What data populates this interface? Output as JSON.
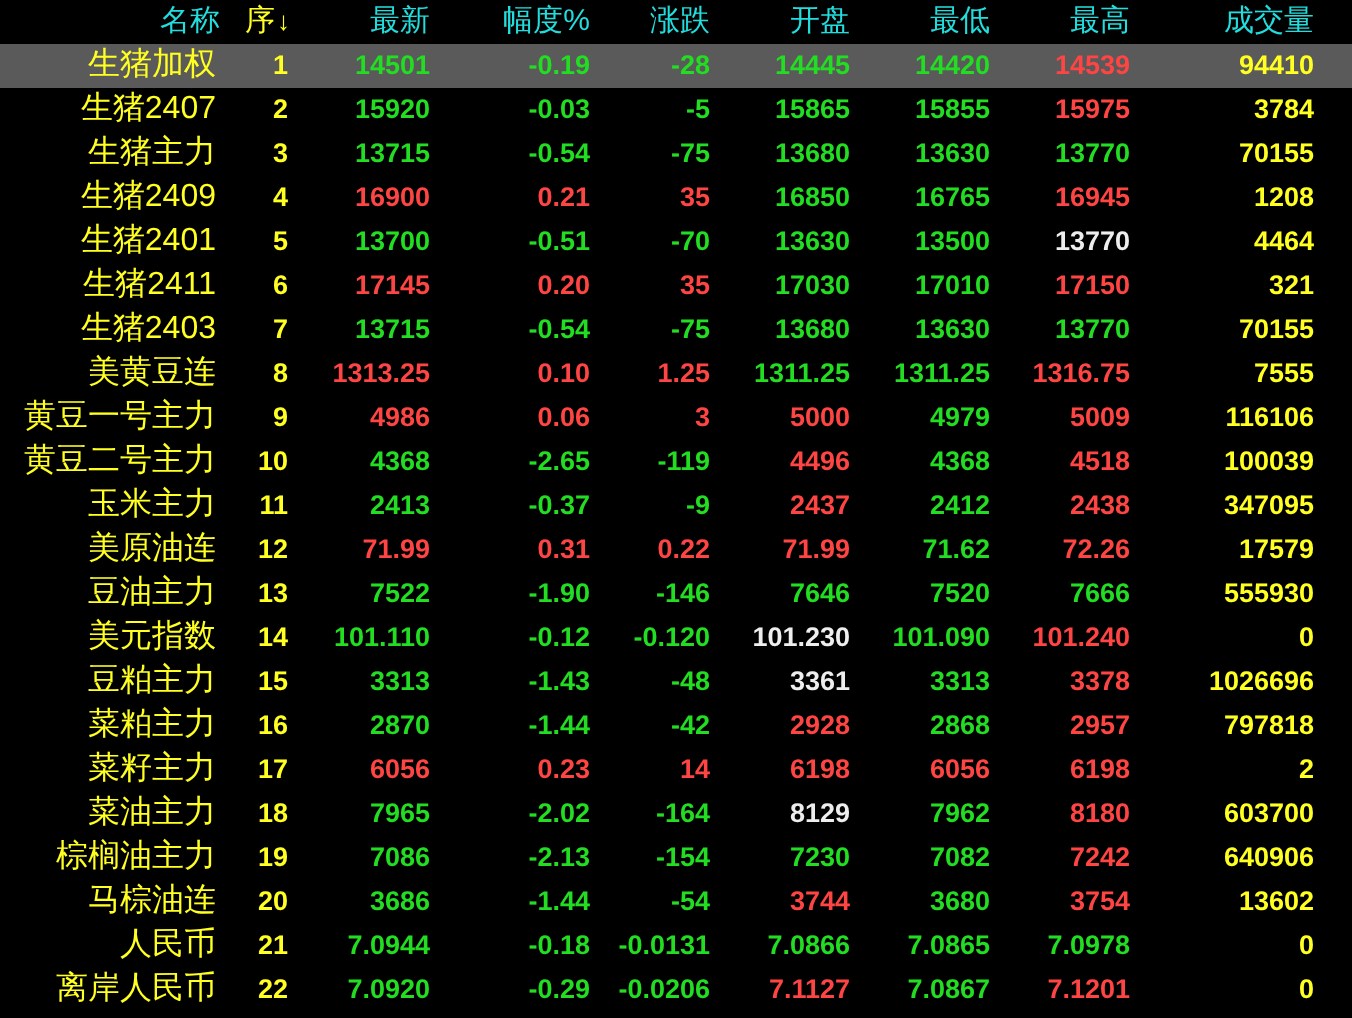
{
  "table": {
    "columns": [
      {
        "label": "名称",
        "sorted": false
      },
      {
        "label": "序",
        "sorted": true
      },
      {
        "label": "最新",
        "sorted": false
      },
      {
        "label": "幅度%",
        "sorted": false
      },
      {
        "label": "涨跌",
        "sorted": false
      },
      {
        "label": "开盘",
        "sorted": false
      },
      {
        "label": "最低",
        "sorted": false
      },
      {
        "label": "最高",
        "sorted": false
      },
      {
        "label": "成交量",
        "sorted": false
      }
    ],
    "sort_arrow": "↓",
    "rows": [
      {
        "selected": true,
        "cells": [
          {
            "text": "生猪加权",
            "color": "#ffff22"
          },
          {
            "text": "1",
            "color": "#ffff22"
          },
          {
            "text": "14501",
            "color": "#22dd22"
          },
          {
            "text": "-0.19",
            "color": "#22dd22"
          },
          {
            "text": "-28",
            "color": "#22dd22"
          },
          {
            "text": "14445",
            "color": "#22dd22"
          },
          {
            "text": "14420",
            "color": "#22dd22"
          },
          {
            "text": "14539",
            "color": "#ff4444"
          },
          {
            "text": "94410",
            "color": "#ffff22"
          }
        ]
      },
      {
        "selected": false,
        "cells": [
          {
            "text": "生猪2407",
            "color": "#ffff22"
          },
          {
            "text": "2",
            "color": "#ffff22"
          },
          {
            "text": "15920",
            "color": "#22dd22"
          },
          {
            "text": "-0.03",
            "color": "#22dd22"
          },
          {
            "text": "-5",
            "color": "#22dd22"
          },
          {
            "text": "15865",
            "color": "#22dd22"
          },
          {
            "text": "15855",
            "color": "#22dd22"
          },
          {
            "text": "15975",
            "color": "#ff4444"
          },
          {
            "text": "3784",
            "color": "#ffff22"
          }
        ]
      },
      {
        "selected": false,
        "cells": [
          {
            "text": "生猪主力",
            "color": "#ffff22"
          },
          {
            "text": "3",
            "color": "#ffff22"
          },
          {
            "text": "13715",
            "color": "#22dd22"
          },
          {
            "text": "-0.54",
            "color": "#22dd22"
          },
          {
            "text": "-75",
            "color": "#22dd22"
          },
          {
            "text": "13680",
            "color": "#22dd22"
          },
          {
            "text": "13630",
            "color": "#22dd22"
          },
          {
            "text": "13770",
            "color": "#22dd22"
          },
          {
            "text": "70155",
            "color": "#ffff22"
          }
        ]
      },
      {
        "selected": false,
        "cells": [
          {
            "text": "生猪2409",
            "color": "#ffff22"
          },
          {
            "text": "4",
            "color": "#ffff22"
          },
          {
            "text": "16900",
            "color": "#ff4444"
          },
          {
            "text": "0.21",
            "color": "#ff4444"
          },
          {
            "text": "35",
            "color": "#ff4444"
          },
          {
            "text": "16850",
            "color": "#22dd22"
          },
          {
            "text": "16765",
            "color": "#22dd22"
          },
          {
            "text": "16945",
            "color": "#ff4444"
          },
          {
            "text": "1208",
            "color": "#ffff22"
          }
        ]
      },
      {
        "selected": false,
        "cells": [
          {
            "text": "生猪2401",
            "color": "#ffff22"
          },
          {
            "text": "5",
            "color": "#ffff22"
          },
          {
            "text": "13700",
            "color": "#22dd22"
          },
          {
            "text": "-0.51",
            "color": "#22dd22"
          },
          {
            "text": "-70",
            "color": "#22dd22"
          },
          {
            "text": "13630",
            "color": "#22dd22"
          },
          {
            "text": "13500",
            "color": "#22dd22"
          },
          {
            "text": "13770",
            "color": "#eeeeee"
          },
          {
            "text": "4464",
            "color": "#ffff22"
          }
        ]
      },
      {
        "selected": false,
        "cells": [
          {
            "text": "生猪2411",
            "color": "#ffff22"
          },
          {
            "text": "6",
            "color": "#ffff22"
          },
          {
            "text": "17145",
            "color": "#ff4444"
          },
          {
            "text": "0.20",
            "color": "#ff4444"
          },
          {
            "text": "35",
            "color": "#ff4444"
          },
          {
            "text": "17030",
            "color": "#22dd22"
          },
          {
            "text": "17010",
            "color": "#22dd22"
          },
          {
            "text": "17150",
            "color": "#ff4444"
          },
          {
            "text": "321",
            "color": "#ffff22"
          }
        ]
      },
      {
        "selected": false,
        "cells": [
          {
            "text": "生猪2403",
            "color": "#ffff22"
          },
          {
            "text": "7",
            "color": "#ffff22"
          },
          {
            "text": "13715",
            "color": "#22dd22"
          },
          {
            "text": "-0.54",
            "color": "#22dd22"
          },
          {
            "text": "-75",
            "color": "#22dd22"
          },
          {
            "text": "13680",
            "color": "#22dd22"
          },
          {
            "text": "13630",
            "color": "#22dd22"
          },
          {
            "text": "13770",
            "color": "#22dd22"
          },
          {
            "text": "70155",
            "color": "#ffff22"
          }
        ]
      },
      {
        "selected": false,
        "cells": [
          {
            "text": "美黄豆连",
            "color": "#ffff22"
          },
          {
            "text": "8",
            "color": "#ffff22"
          },
          {
            "text": "1313.25",
            "color": "#ff4444"
          },
          {
            "text": "0.10",
            "color": "#ff4444"
          },
          {
            "text": "1.25",
            "color": "#ff4444"
          },
          {
            "text": "1311.25",
            "color": "#22dd22"
          },
          {
            "text": "1311.25",
            "color": "#22dd22"
          },
          {
            "text": "1316.75",
            "color": "#ff4444"
          },
          {
            "text": "7555",
            "color": "#ffff22"
          }
        ]
      },
      {
        "selected": false,
        "cells": [
          {
            "text": "黄豆一号主力",
            "color": "#ffff22"
          },
          {
            "text": "9",
            "color": "#ffff22"
          },
          {
            "text": "4986",
            "color": "#ff4444"
          },
          {
            "text": "0.06",
            "color": "#ff4444"
          },
          {
            "text": "3",
            "color": "#ff4444"
          },
          {
            "text": "5000",
            "color": "#ff4444"
          },
          {
            "text": "4979",
            "color": "#22dd22"
          },
          {
            "text": "5009",
            "color": "#ff4444"
          },
          {
            "text": "116106",
            "color": "#ffff22"
          }
        ]
      },
      {
        "selected": false,
        "cells": [
          {
            "text": "黄豆二号主力",
            "color": "#ffff22"
          },
          {
            "text": "10",
            "color": "#ffff22"
          },
          {
            "text": "4368",
            "color": "#22dd22"
          },
          {
            "text": "-2.65",
            "color": "#22dd22"
          },
          {
            "text": "-119",
            "color": "#22dd22"
          },
          {
            "text": "4496",
            "color": "#ff4444"
          },
          {
            "text": "4368",
            "color": "#22dd22"
          },
          {
            "text": "4518",
            "color": "#ff4444"
          },
          {
            "text": "100039",
            "color": "#ffff22"
          }
        ]
      },
      {
        "selected": false,
        "cells": [
          {
            "text": "玉米主力",
            "color": "#ffff22"
          },
          {
            "text": "11",
            "color": "#ffff22"
          },
          {
            "text": "2413",
            "color": "#22dd22"
          },
          {
            "text": "-0.37",
            "color": "#22dd22"
          },
          {
            "text": "-9",
            "color": "#22dd22"
          },
          {
            "text": "2437",
            "color": "#ff4444"
          },
          {
            "text": "2412",
            "color": "#22dd22"
          },
          {
            "text": "2438",
            "color": "#ff4444"
          },
          {
            "text": "347095",
            "color": "#ffff22"
          }
        ]
      },
      {
        "selected": false,
        "cells": [
          {
            "text": "美原油连",
            "color": "#ffff22"
          },
          {
            "text": "12",
            "color": "#ffff22"
          },
          {
            "text": "71.99",
            "color": "#ff4444"
          },
          {
            "text": "0.31",
            "color": "#ff4444"
          },
          {
            "text": "0.22",
            "color": "#ff4444"
          },
          {
            "text": "71.99",
            "color": "#ff4444"
          },
          {
            "text": "71.62",
            "color": "#22dd22"
          },
          {
            "text": "72.26",
            "color": "#ff4444"
          },
          {
            "text": "17579",
            "color": "#ffff22"
          }
        ]
      },
      {
        "selected": false,
        "cells": [
          {
            "text": "豆油主力",
            "color": "#ffff22"
          },
          {
            "text": "13",
            "color": "#ffff22"
          },
          {
            "text": "7522",
            "color": "#22dd22"
          },
          {
            "text": "-1.90",
            "color": "#22dd22"
          },
          {
            "text": "-146",
            "color": "#22dd22"
          },
          {
            "text": "7646",
            "color": "#22dd22"
          },
          {
            "text": "7520",
            "color": "#22dd22"
          },
          {
            "text": "7666",
            "color": "#22dd22"
          },
          {
            "text": "555930",
            "color": "#ffff22"
          }
        ]
      },
      {
        "selected": false,
        "cells": [
          {
            "text": "美元指数",
            "color": "#ffff22"
          },
          {
            "text": "14",
            "color": "#ffff22"
          },
          {
            "text": "101.110",
            "color": "#22dd22"
          },
          {
            "text": "-0.12",
            "color": "#22dd22"
          },
          {
            "text": "-0.120",
            "color": "#22dd22"
          },
          {
            "text": "101.230",
            "color": "#eeeeee"
          },
          {
            "text": "101.090",
            "color": "#22dd22"
          },
          {
            "text": "101.240",
            "color": "#ff4444"
          },
          {
            "text": "0",
            "color": "#ffff22"
          }
        ]
      },
      {
        "selected": false,
        "cells": [
          {
            "text": "豆粕主力",
            "color": "#ffff22"
          },
          {
            "text": "15",
            "color": "#ffff22"
          },
          {
            "text": "3313",
            "color": "#22dd22"
          },
          {
            "text": "-1.43",
            "color": "#22dd22"
          },
          {
            "text": "-48",
            "color": "#22dd22"
          },
          {
            "text": "3361",
            "color": "#eeeeee"
          },
          {
            "text": "3313",
            "color": "#22dd22"
          },
          {
            "text": "3378",
            "color": "#ff4444"
          },
          {
            "text": "1026696",
            "color": "#ffff22"
          }
        ]
      },
      {
        "selected": false,
        "cells": [
          {
            "text": "菜粕主力",
            "color": "#ffff22"
          },
          {
            "text": "16",
            "color": "#ffff22"
          },
          {
            "text": "2870",
            "color": "#22dd22"
          },
          {
            "text": "-1.44",
            "color": "#22dd22"
          },
          {
            "text": "-42",
            "color": "#22dd22"
          },
          {
            "text": "2928",
            "color": "#ff4444"
          },
          {
            "text": "2868",
            "color": "#22dd22"
          },
          {
            "text": "2957",
            "color": "#ff4444"
          },
          {
            "text": "797818",
            "color": "#ffff22"
          }
        ]
      },
      {
        "selected": false,
        "cells": [
          {
            "text": "菜籽主力",
            "color": "#ffff22"
          },
          {
            "text": "17",
            "color": "#ffff22"
          },
          {
            "text": "6056",
            "color": "#ff4444"
          },
          {
            "text": "0.23",
            "color": "#ff4444"
          },
          {
            "text": "14",
            "color": "#ff4444"
          },
          {
            "text": "6198",
            "color": "#ff4444"
          },
          {
            "text": "6056",
            "color": "#ff4444"
          },
          {
            "text": "6198",
            "color": "#ff4444"
          },
          {
            "text": "2",
            "color": "#ffff22"
          }
        ]
      },
      {
        "selected": false,
        "cells": [
          {
            "text": "菜油主力",
            "color": "#ffff22"
          },
          {
            "text": "18",
            "color": "#ffff22"
          },
          {
            "text": "7965",
            "color": "#22dd22"
          },
          {
            "text": "-2.02",
            "color": "#22dd22"
          },
          {
            "text": "-164",
            "color": "#22dd22"
          },
          {
            "text": "8129",
            "color": "#eeeeee"
          },
          {
            "text": "7962",
            "color": "#22dd22"
          },
          {
            "text": "8180",
            "color": "#ff4444"
          },
          {
            "text": "603700",
            "color": "#ffff22"
          }
        ]
      },
      {
        "selected": false,
        "cells": [
          {
            "text": "棕榈油主力",
            "color": "#ffff22"
          },
          {
            "text": "19",
            "color": "#ffff22"
          },
          {
            "text": "7086",
            "color": "#22dd22"
          },
          {
            "text": "-2.13",
            "color": "#22dd22"
          },
          {
            "text": "-154",
            "color": "#22dd22"
          },
          {
            "text": "7230",
            "color": "#22dd22"
          },
          {
            "text": "7082",
            "color": "#22dd22"
          },
          {
            "text": "7242",
            "color": "#ff4444"
          },
          {
            "text": "640906",
            "color": "#ffff22"
          }
        ]
      },
      {
        "selected": false,
        "cells": [
          {
            "text": "马棕油连",
            "color": "#ffff22"
          },
          {
            "text": "20",
            "color": "#ffff22"
          },
          {
            "text": "3686",
            "color": "#22dd22"
          },
          {
            "text": "-1.44",
            "color": "#22dd22"
          },
          {
            "text": "-54",
            "color": "#22dd22"
          },
          {
            "text": "3744",
            "color": "#ff4444"
          },
          {
            "text": "3680",
            "color": "#22dd22"
          },
          {
            "text": "3754",
            "color": "#ff4444"
          },
          {
            "text": "13602",
            "color": "#ffff22"
          }
        ]
      },
      {
        "selected": false,
        "cells": [
          {
            "text": "人民币",
            "color": "#ffff22"
          },
          {
            "text": "21",
            "color": "#ffff22"
          },
          {
            "text": "7.0944",
            "color": "#22dd22"
          },
          {
            "text": "-0.18",
            "color": "#22dd22"
          },
          {
            "text": "-0.0131",
            "color": "#22dd22"
          },
          {
            "text": "7.0866",
            "color": "#22dd22"
          },
          {
            "text": "7.0865",
            "color": "#22dd22"
          },
          {
            "text": "7.0978",
            "color": "#22dd22"
          },
          {
            "text": "0",
            "color": "#ffff22"
          }
        ]
      },
      {
        "selected": false,
        "cells": [
          {
            "text": "离岸人民币",
            "color": "#ffff22"
          },
          {
            "text": "22",
            "color": "#ffff22"
          },
          {
            "text": "7.0920",
            "color": "#22dd22"
          },
          {
            "text": "-0.29",
            "color": "#22dd22"
          },
          {
            "text": "-0.0206",
            "color": "#22dd22"
          },
          {
            "text": "7.1127",
            "color": "#ff4444"
          },
          {
            "text": "7.0867",
            "color": "#22dd22"
          },
          {
            "text": "7.1201",
            "color": "#ff4444"
          },
          {
            "text": "0",
            "color": "#ffff22"
          }
        ]
      }
    ]
  }
}
